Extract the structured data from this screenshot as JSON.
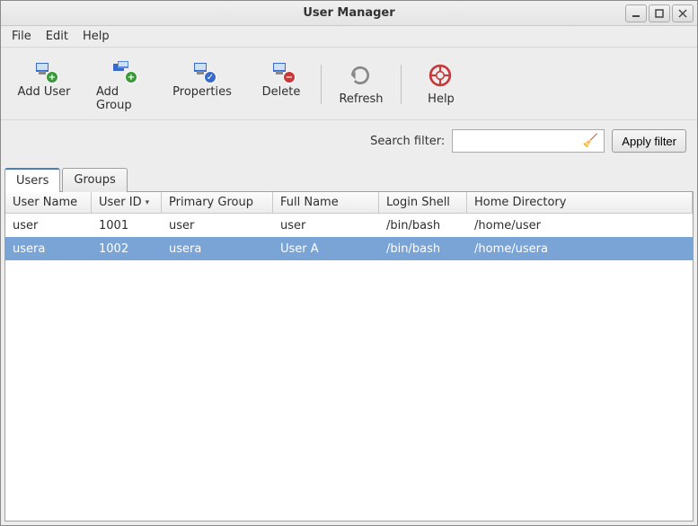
{
  "window": {
    "title": "User Manager"
  },
  "menu": {
    "file": "File",
    "edit": "Edit",
    "help": "Help"
  },
  "toolbar": {
    "add_user": "Add User",
    "add_group": "Add Group",
    "properties": "Properties",
    "delete": "Delete",
    "refresh": "Refresh",
    "help": "Help"
  },
  "search": {
    "label": "Search filter:",
    "value": "",
    "apply": "Apply filter"
  },
  "tabs": {
    "users": "Users",
    "groups": "Groups"
  },
  "columns": {
    "username": "User Name",
    "userid": "User ID",
    "pgroup": "Primary Group",
    "fullname": "Full Name",
    "shell": "Login Shell",
    "home": "Home Directory"
  },
  "rows": [
    {
      "username": "user",
      "userid": "1001",
      "pgroup": "user",
      "fullname": "user",
      "shell": "/bin/bash",
      "home": "/home/user"
    },
    {
      "username": "usera",
      "userid": "1002",
      "pgroup": "usera",
      "fullname": "User A",
      "shell": "/bin/bash",
      "home": "/home/usera"
    }
  ],
  "selected_row": 1,
  "sort_column": "userid"
}
